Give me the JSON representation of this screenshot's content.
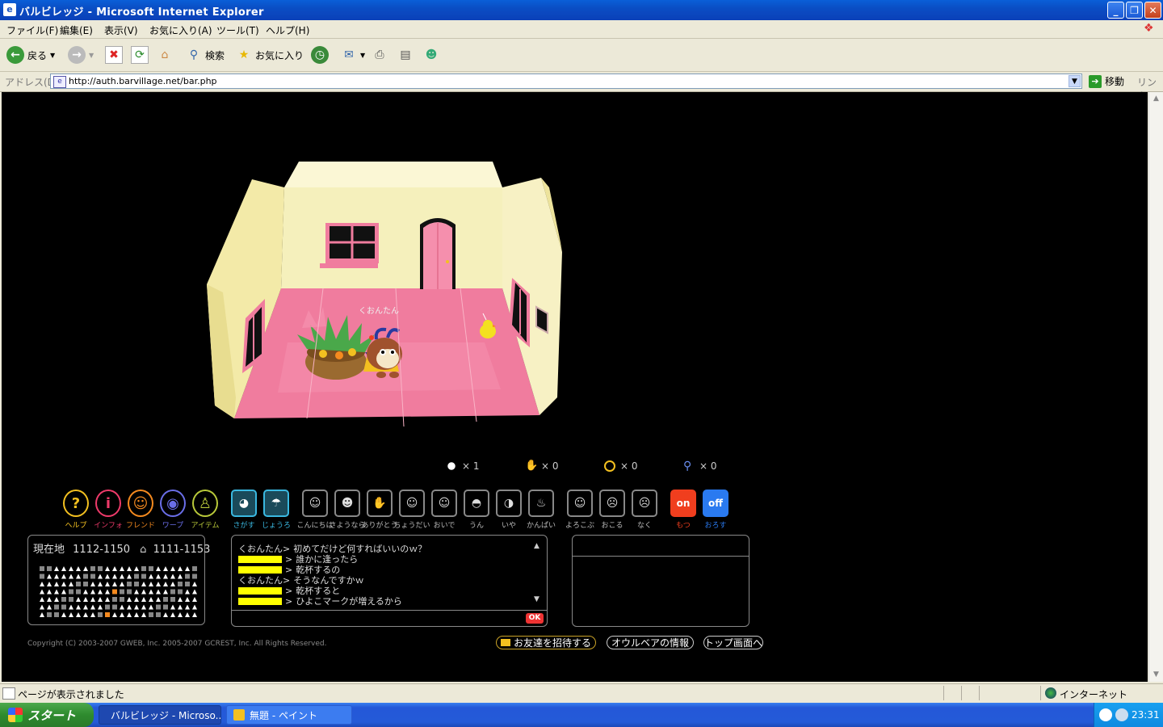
{
  "window": {
    "title": "バルビレッジ - Microsoft Internet Explorer"
  },
  "menu": [
    "ファイル(F)",
    "編集(E)",
    "表示(V)",
    "お気に入り(A)",
    "ツール(T)",
    "ヘルプ(H)"
  ],
  "toolbar": {
    "back": "戻る",
    "search": "検索",
    "favorites": "お気に入り"
  },
  "address": {
    "label": "アドレス(D)",
    "url": "http://auth.barvillage.net/bar.php",
    "go": "移動",
    "links": "リンク"
  },
  "game": {
    "player_name": "くおんたん",
    "stats": [
      {
        "icon": "chick-icon",
        "value": "× 1"
      },
      {
        "icon": "hand-icon",
        "value": "× 0"
      },
      {
        "icon": "coin-icon",
        "value": "× 0"
      },
      {
        "icon": "pin-icon",
        "value": "× 0"
      }
    ],
    "nav_buttons": [
      {
        "label": "ヘルプ",
        "glyph": "?",
        "color": "#f3c020"
      },
      {
        "label": "インフォ",
        "glyph": "i",
        "color": "#ee3a6a"
      },
      {
        "label": "フレンド",
        "glyph": "☺",
        "color": "#f58a1f"
      },
      {
        "label": "ワープ",
        "glyph": "◉",
        "color": "#6a6ee8"
      },
      {
        "label": "アイテム",
        "glyph": "♙",
        "color": "#b9c93a"
      }
    ],
    "action_buttons": [
      "さがす",
      "じょうろ",
      "こんにちは",
      "さようなら",
      "ありがとう",
      "ちょうだい",
      "おいで",
      "うん",
      "いや",
      "かんぱい",
      "よろこぶ",
      "おこる",
      "なく"
    ],
    "onoff_buttons": [
      {
        "label": "もつ",
        "glyph": "on",
        "color": "#f03e1e"
      },
      {
        "label": "おろす",
        "glyph": "off",
        "color": "#2a7af0"
      }
    ],
    "location": {
      "label": "現在地",
      "coord1": "1112-1150",
      "coord2": "1111-1153"
    },
    "chat": [
      {
        "name": "くおんたん>",
        "text": "初めてだけど何すればいいのｗ？",
        "hidden_name": false
      },
      {
        "name": ">",
        "text": "誰かに逢ったら",
        "hidden_name": true
      },
      {
        "name": ">",
        "text": "乾杯するの",
        "hidden_name": true
      },
      {
        "name": "くおんたん>",
        "text": "そうなんですかｗ",
        "hidden_name": false
      },
      {
        "name": ">",
        "text": "乾杯すると",
        "hidden_name": true
      },
      {
        "name": ">",
        "text": "ひよこマークが増えるから",
        "hidden_name": true
      }
    ],
    "ok_label": "OK",
    "copyright": "Copyright (C) 2003-2007 GWEB, Inc. 2005-2007 GCREST, Inc. All Rights Reserved.",
    "links": [
      "お友達を招待する",
      "オウルベアの情報",
      "トップ画面へ"
    ]
  },
  "status": {
    "text": "ページが表示されました",
    "zone": "インターネット"
  },
  "taskbar": {
    "start": "スタート",
    "tasks": [
      "バルビレッジ - Microso...",
      "無題 - ペイント"
    ],
    "clock": "23:31"
  }
}
